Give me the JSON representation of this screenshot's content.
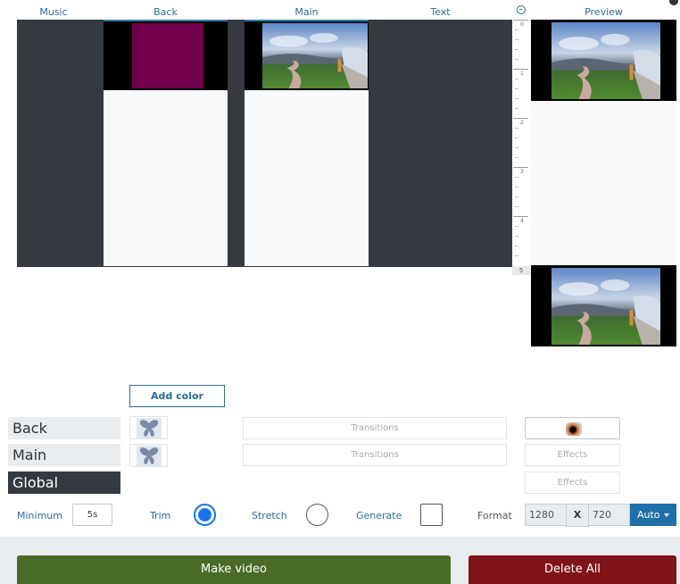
{
  "columns": {
    "music": "Music",
    "back": "Back",
    "main": "Main",
    "text": "Text",
    "preview": "Preview"
  },
  "ruler": {
    "marks": [
      "0",
      "1",
      "2",
      "3",
      "4"
    ],
    "end_mark": "5"
  },
  "icons": {
    "ruler_clock": "clock-icon",
    "close": "close-icon",
    "layer_thumb": "butterfly-icon",
    "effect_thumb": "eye-icon"
  },
  "colors": {
    "back_clip": "#72004f",
    "make_video": "#4a6b27",
    "delete_all": "#7f1318",
    "auto": "#1f6fa8",
    "accent_text": "#2a6a94"
  },
  "add_color_label": "Add color",
  "layers": [
    {
      "label": "Back",
      "transitions": "Transitions"
    },
    {
      "label": "Main",
      "transitions": "Transitions"
    },
    {
      "label": "Global"
    }
  ],
  "effects": [
    "Effects",
    "Effects"
  ],
  "controls": {
    "minimum_label": "Minimum",
    "minimum_value": "5s",
    "trim_label": "Trim",
    "trim_checked": true,
    "stretch_label": "Stretch",
    "stretch_checked": false,
    "generate_label": "Generate",
    "generate_checked": false,
    "format_label": "Format",
    "width": "1280",
    "x_sep": "X",
    "height": "720",
    "auto_label": "Auto"
  },
  "footer": {
    "make_video": "Make video",
    "delete_all": "Delete All"
  }
}
